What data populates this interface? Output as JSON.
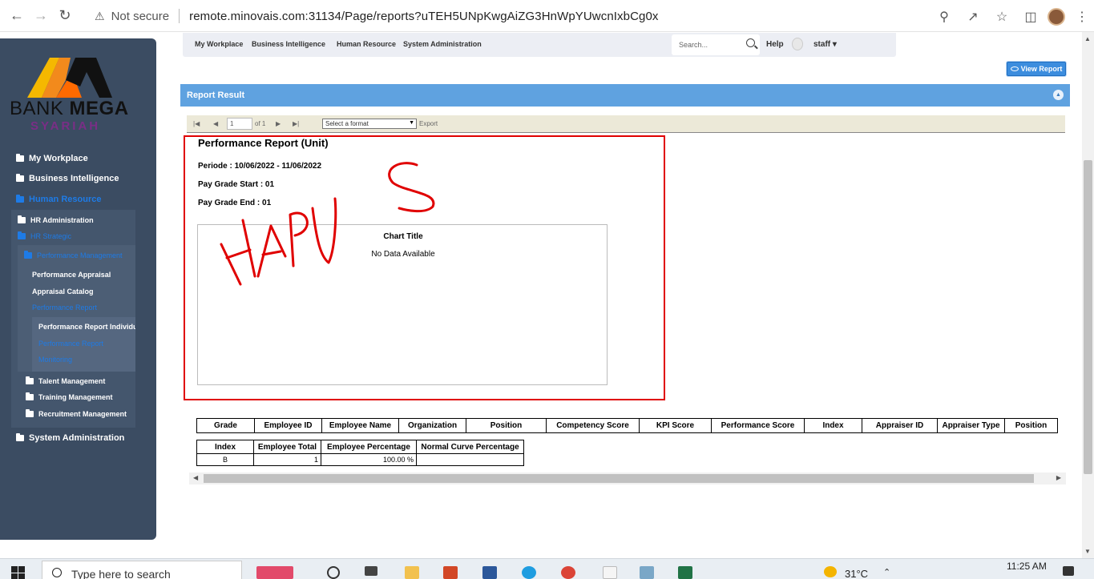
{
  "browser": {
    "security_label": "Not secure",
    "url": "remote.minovais.com:31134/Page/reports?uTEH5UNpKwgAiZG3HnWpYUwcnIxbCg0x"
  },
  "topnav": {
    "items": [
      "My Workplace",
      "Business Intelligence",
      "Human Resource",
      "System Administration"
    ],
    "search_placeholder": "Search...",
    "help": "Help",
    "user": "staff"
  },
  "sidebar": {
    "brand_bank": "BANK",
    "brand_mega": "MEGA",
    "brand_sub": "SYARIAH",
    "items": [
      "My Workplace",
      "Business Intelligence",
      "Human Resource",
      "HR Administration",
      "HR Strategic",
      "Performance Management",
      "Performance Appraisal",
      "Appraisal Catalog",
      "Performance Report",
      "Performance Report Individu",
      "Performance Report",
      "Monitoring",
      "Talent Management",
      "Training Management",
      "Recruitment Management",
      "System Administration"
    ]
  },
  "view_report_button": "View Report",
  "report_result": {
    "header": "Report Result",
    "toolbar": {
      "page_value": "1",
      "of_label": "of 1",
      "format_select": "Select a format",
      "export": "Export"
    },
    "title": "Performance Report (Unit)",
    "periode": "Periode : 10/06/2022 - 11/06/2022",
    "pay_grade_start": "Pay Grade Start : 01",
    "pay_grade_end": "Pay Grade End : 01",
    "chart_title": "Chart Title",
    "no_data": "No Data Available",
    "annotation": "HAPUS"
  },
  "table_main": {
    "headers": [
      "Grade",
      "Employee ID",
      "Employee Name",
      "Organization",
      "Position",
      "Competency Score",
      "KPI Score",
      "Performance Score",
      "Index",
      "Appraiser ID",
      "Appraiser Type",
      "Position"
    ]
  },
  "table_summary": {
    "headers": [
      "Index",
      "Employee Total",
      "Employee Percentage",
      "Normal Curve Percentage"
    ],
    "rows": [
      [
        "B",
        "1",
        "100.00 %",
        ""
      ]
    ]
  },
  "taskbar": {
    "search_placeholder": "Type here to search",
    "temperature": "31°C",
    "time": "11:25 AM"
  },
  "colors": {
    "sidebar_bg": "#3b4c62",
    "active_nav": "#1e7be6",
    "report_header_bg": "#5fa2e0",
    "annotation_red": "#e00000"
  }
}
